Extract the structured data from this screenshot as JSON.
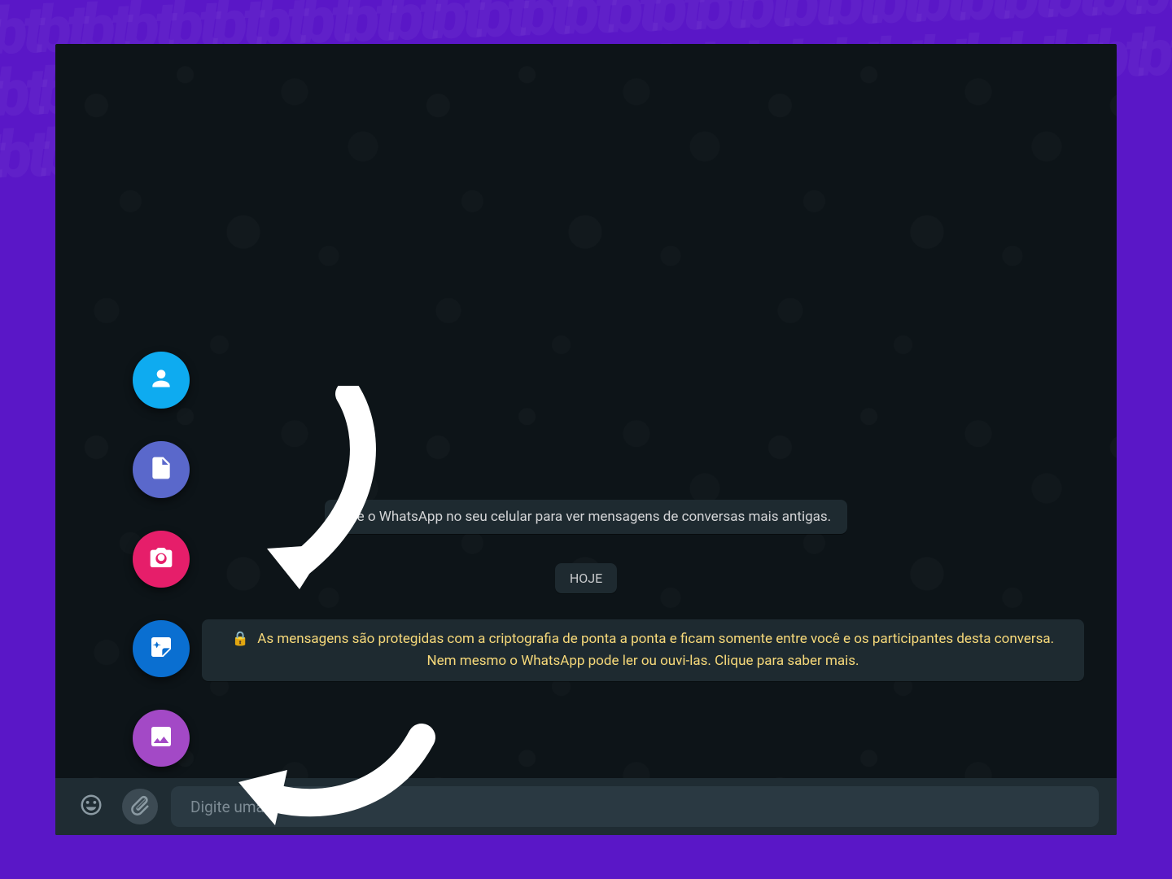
{
  "chat": {
    "system_message": "Use o WhatsApp no seu celular para ver mensagens de conversas mais antigas.",
    "date_label": "HOJE",
    "encryption_notice": "As mensagens são protegidas com a criptografia de ponta a ponta e ficam somente entre você e os participantes desta conversa. Nem mesmo o WhatsApp pode ler ou ouvi-las. Clique para saber mais.",
    "lock_glyph": "🔒"
  },
  "composer": {
    "placeholder": "Digite uma mensagem"
  },
  "attachment_menu": {
    "items": [
      {
        "name": "gallery",
        "semantic": "image-icon"
      },
      {
        "name": "sticker",
        "semantic": "sticker-icon"
      },
      {
        "name": "camera",
        "semantic": "camera-icon"
      },
      {
        "name": "document",
        "semantic": "document-icon"
      },
      {
        "name": "contact",
        "semantic": "person-icon"
      }
    ]
  },
  "colors": {
    "frame": "#5a17c7",
    "chat_bg": "#0d1418",
    "pill_bg": "#1e2a30",
    "composer_bg": "#1f2c33",
    "input_bg": "#2a3942",
    "encryption_text": "#f7d97a",
    "fab_contact": "#0eabf0",
    "fab_document": "#5a68cb",
    "fab_camera": "#e61e6a",
    "fab_sticker": "#0a6fd1",
    "fab_gallery": "#a349c6"
  }
}
